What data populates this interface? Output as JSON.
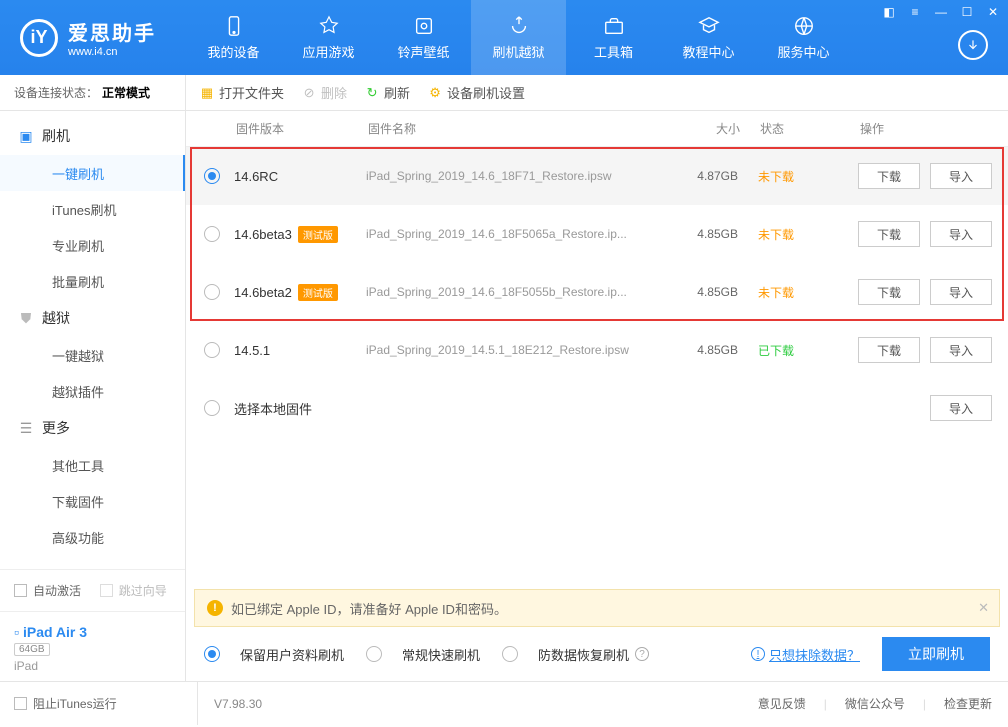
{
  "brand": {
    "title": "爱思助手",
    "subtitle": "www.i4.cn"
  },
  "topnav": {
    "items": [
      {
        "label": "我的设备"
      },
      {
        "label": "应用游戏"
      },
      {
        "label": "铃声壁纸"
      },
      {
        "label": "刷机越狱"
      },
      {
        "label": "工具箱"
      },
      {
        "label": "教程中心"
      },
      {
        "label": "服务中心"
      }
    ]
  },
  "connection": {
    "label": "设备连接状态：",
    "value": "正常模式"
  },
  "sidebar": {
    "flash": {
      "label": "刷机",
      "children": [
        "一键刷机",
        "iTunes刷机",
        "专业刷机",
        "批量刷机"
      ]
    },
    "jailbreak": {
      "label": "越狱",
      "children": [
        "一键越狱",
        "越狱插件"
      ]
    },
    "more": {
      "label": "更多",
      "children": [
        "其他工具",
        "下载固件",
        "高级功能"
      ]
    }
  },
  "devicebox": {
    "auto_activate": "自动激活",
    "skip_guide": "跳过向导",
    "device_name": "iPad Air 3",
    "capacity": "64GB",
    "model": "iPad"
  },
  "toolbar": {
    "open": "打开文件夹",
    "delete": "删除",
    "refresh": "刷新",
    "settings": "设备刷机设置"
  },
  "columns": {
    "ver": "固件版本",
    "name": "固件名称",
    "size": "大小",
    "status": "状态",
    "op": "操作"
  },
  "beta_badge": "测试版",
  "status_labels": {
    "undl": "未下载",
    "dl": "已下载"
  },
  "buttons": {
    "download": "下载",
    "import": "导入"
  },
  "rows": [
    {
      "ver": "14.6RC",
      "beta": false,
      "name": "iPad_Spring_2019_14.6_18F71_Restore.ipsw",
      "size": "4.87GB",
      "status": "undl",
      "selected": true,
      "download": true
    },
    {
      "ver": "14.6beta3",
      "beta": true,
      "name": "iPad_Spring_2019_14.6_18F5065a_Restore.ip...",
      "size": "4.85GB",
      "status": "undl",
      "selected": false,
      "download": true
    },
    {
      "ver": "14.6beta2",
      "beta": true,
      "name": "iPad_Spring_2019_14.6_18F5055b_Restore.ip...",
      "size": "4.85GB",
      "status": "undl",
      "selected": false,
      "download": true
    },
    {
      "ver": "14.5.1",
      "beta": false,
      "name": "iPad_Spring_2019_14.5.1_18E212_Restore.ipsw",
      "size": "4.85GB",
      "status": "dl",
      "selected": false,
      "download": true
    }
  ],
  "local_row": "选择本地固件",
  "warning": "如已绑定 Apple ID，请准备好 Apple ID和密码。",
  "options": {
    "opt1": "保留用户资料刷机",
    "opt2": "常规快速刷机",
    "opt3": "防数据恢复刷机",
    "erase_link": "只想抹除数据？",
    "go": "立即刷机"
  },
  "footer": {
    "block_itunes": "阻止iTunes运行",
    "version": "V7.98.30",
    "feedback": "意见反馈",
    "wechat": "微信公众号",
    "update": "检查更新"
  }
}
